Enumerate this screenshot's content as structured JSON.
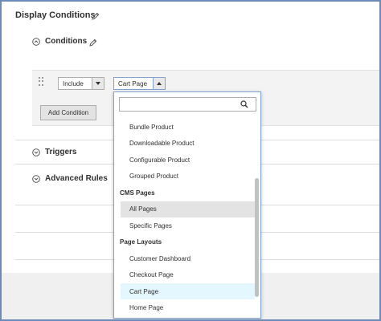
{
  "header": {
    "title": "Display Conditions"
  },
  "conditions_section": {
    "title": "Conditions"
  },
  "rule": {
    "include_value": "Include",
    "page_value": "Cart Page",
    "add_condition_label": "Add Condition"
  },
  "sections": [
    {
      "title": "Triggers"
    },
    {
      "title": "Advanced Rules"
    }
  ],
  "dropdown": {
    "search_value": "",
    "scroll_position": 0.75,
    "groups": [
      {
        "label": "",
        "items": [
          {
            "label": "Bundle Product"
          },
          {
            "label": "Downloadable Product"
          },
          {
            "label": "Configurable Product"
          },
          {
            "label": "Grouped Product"
          }
        ]
      },
      {
        "label": "CMS Pages",
        "items": [
          {
            "label": "All Pages",
            "state": "hover"
          },
          {
            "label": "Specific Pages"
          }
        ]
      },
      {
        "label": "Page Layouts",
        "items": [
          {
            "label": "Customer Dashboard"
          },
          {
            "label": "Checkout Page"
          },
          {
            "label": "Cart Page",
            "state": "selected"
          },
          {
            "label": "Home Page"
          }
        ]
      }
    ]
  },
  "icons": {
    "edit": "pencil-icon",
    "collapse": "circle-chevron-up-icon",
    "expand": "circle-chevron-down-icon",
    "search": "search-icon",
    "drag": "drag-handle-icon",
    "arrow_down": "triangle-down-icon",
    "arrow_up": "triangle-up-icon"
  },
  "colors": {
    "frame_border": "#6d8bb8",
    "dropdown_border": "#7fa4d0",
    "hover_bg": "#e3e3e3",
    "selected_bg": "#e5f7fe"
  }
}
